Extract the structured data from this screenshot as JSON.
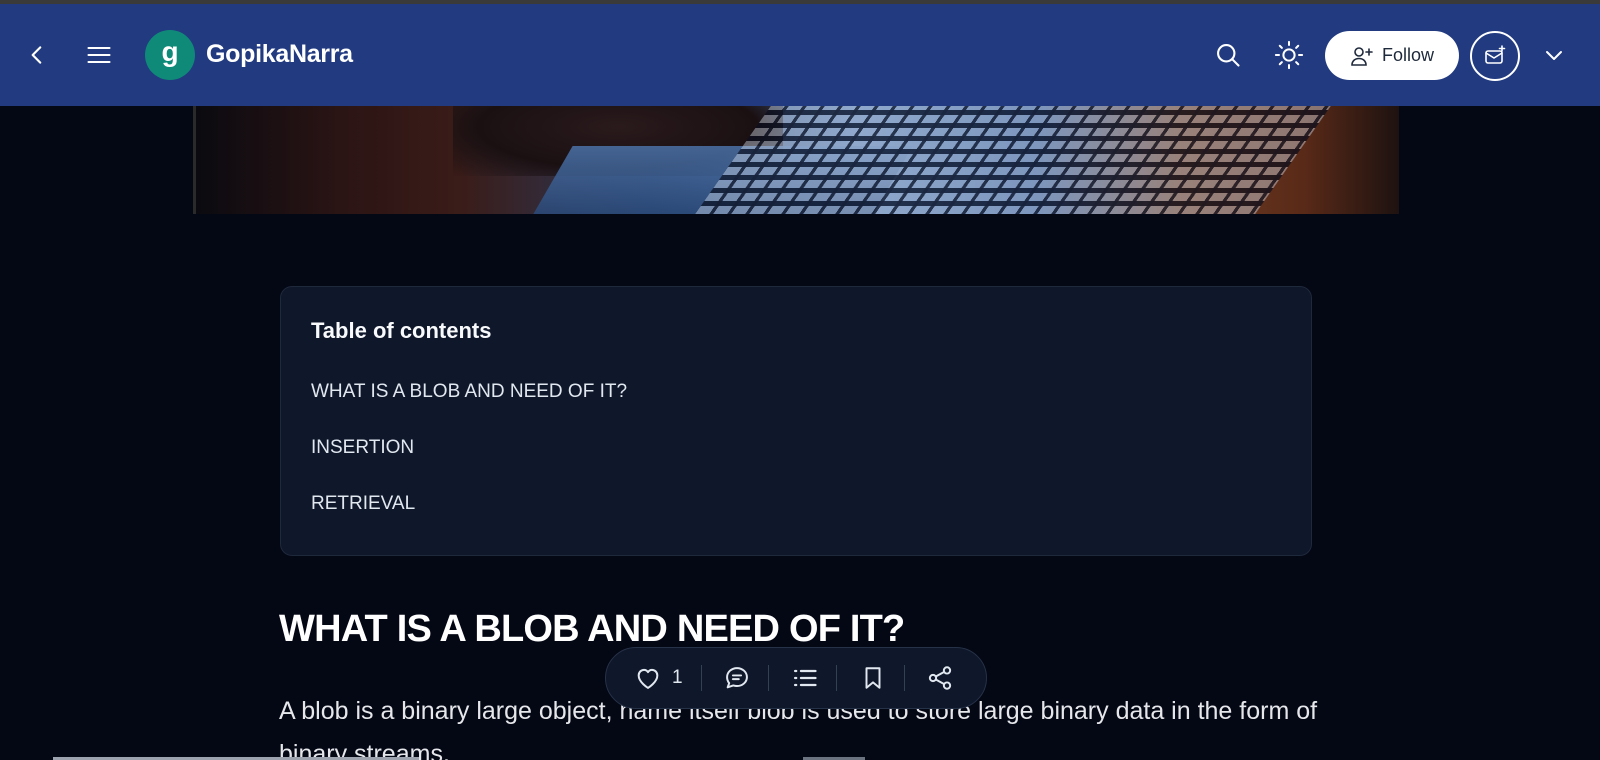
{
  "header": {
    "avatar_letter": "g",
    "blog_name": "GopikaNarra",
    "follow_label": "Follow",
    "background_color": "#213a80",
    "avatar_color": "#0f8a78",
    "icons": [
      "chevron-left-icon",
      "menu-icon",
      "search-icon",
      "sun-icon",
      "user-plus-icon",
      "newsletter-icon",
      "chevron-down-icon"
    ]
  },
  "toc": {
    "title": "Table of contents",
    "items": [
      {
        "label": "WHAT IS A BLOB AND NEED OF IT?"
      },
      {
        "label": "INSERTION"
      },
      {
        "label": "RETRIEVAL"
      }
    ]
  },
  "article": {
    "heading": "WHAT IS A BLOB AND NEED OF IT?",
    "paragraph": "A blob is a binary large object, name itself blob is used to store large binary data in the form of binary streams."
  },
  "actionbar": {
    "like_count": "1",
    "icons": [
      "heart-icon",
      "comment-icon",
      "list-icon",
      "bookmark-icon",
      "share-icon"
    ]
  },
  "theme": {
    "page_background": "#040714",
    "card_background": "#0f172a"
  }
}
